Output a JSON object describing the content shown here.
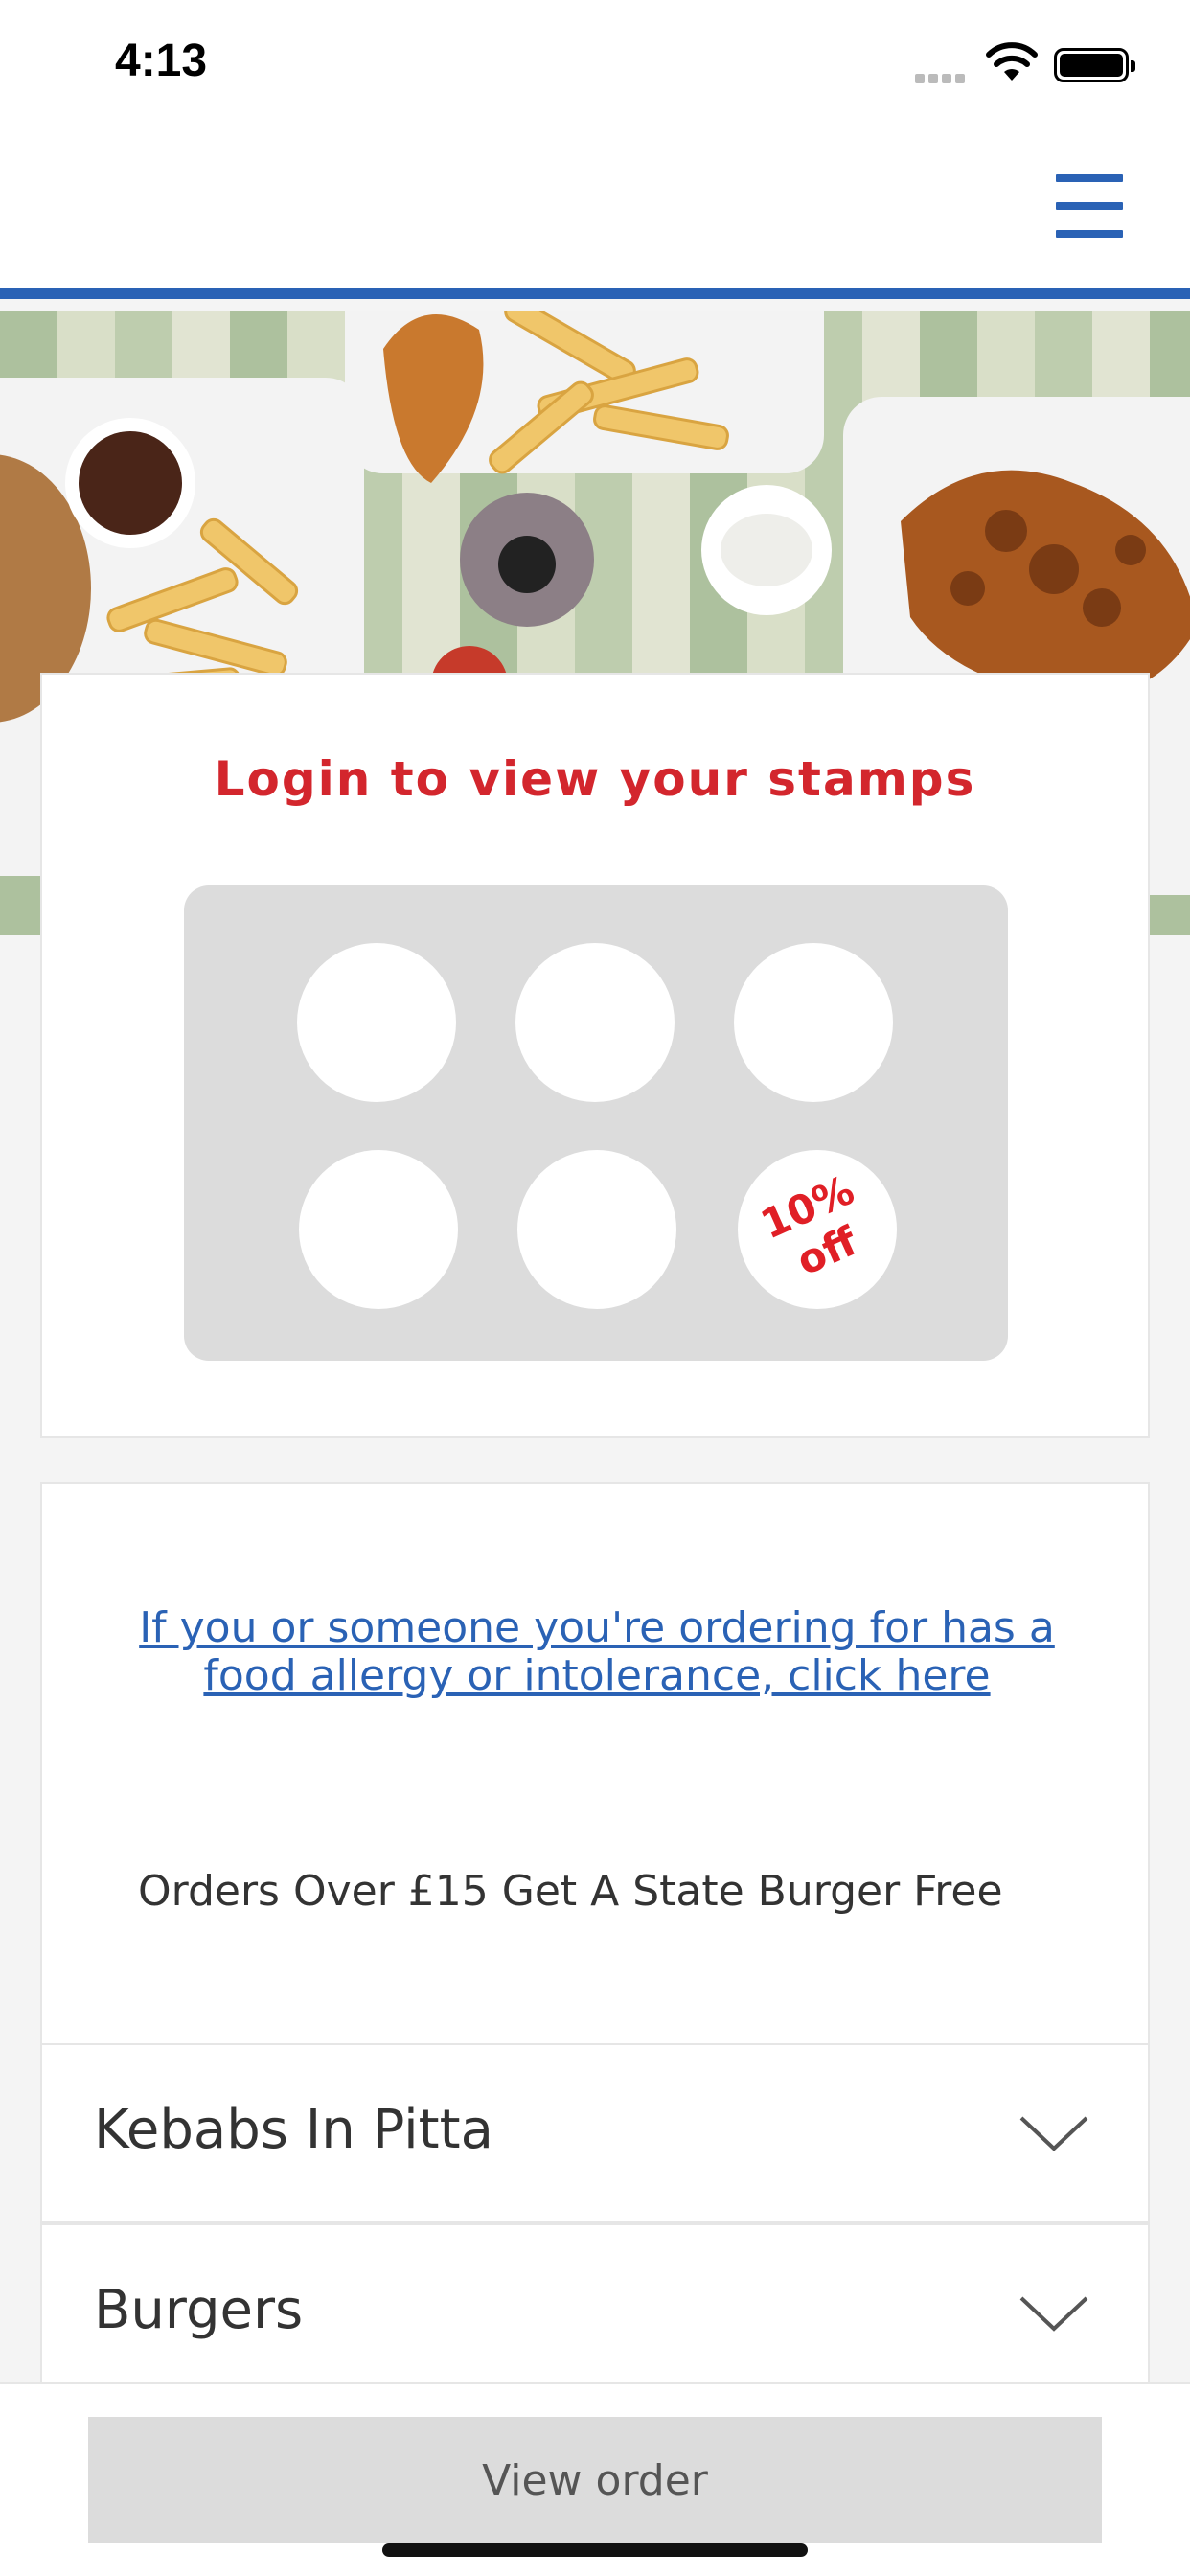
{
  "status_bar": {
    "time": "4:13"
  },
  "header": {
    "menu_icon": "hamburger-menu-icon",
    "accent_color": "#2a62b5"
  },
  "loyalty": {
    "title": "Login to view your stamps",
    "stamps_total": 6,
    "reward_label_line1": "10%",
    "reward_label_line2": "off",
    "title_color": "#d3262d"
  },
  "info": {
    "allergy_link": "If you or someone you're ordering for has a food allergy or intolerance, click here",
    "promo": "Orders Over £15 Get A State Burger Free"
  },
  "categories": [
    {
      "label": "Kebabs In Pitta",
      "icon": "chevron-down-icon"
    },
    {
      "label": "Burgers",
      "icon": "chevron-down-icon"
    }
  ],
  "footer": {
    "view_order_label": "View order"
  }
}
